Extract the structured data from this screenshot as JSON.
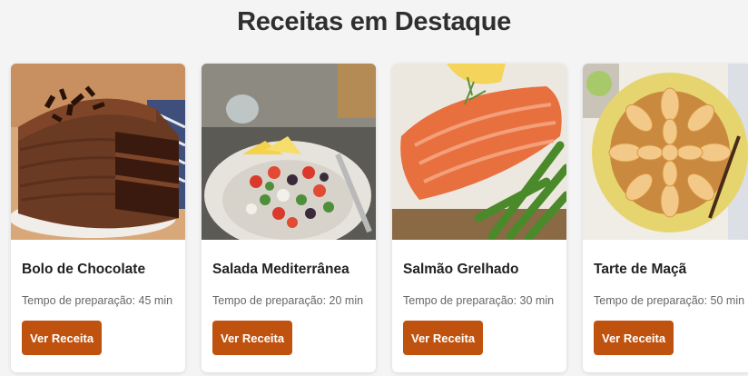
{
  "page": {
    "title": "Receitas em Destaque"
  },
  "recipes": [
    {
      "image": "chocolate-cake-photo",
      "title": "Bolo de Chocolate",
      "prep": "Tempo de preparação: 45 min",
      "button": "Ver Receita"
    },
    {
      "image": "mediterranean-salad-photo",
      "title": "Salada Mediterrânea",
      "prep": "Tempo de preparação: 20 min",
      "button": "Ver Receita"
    },
    {
      "image": "grilled-salmon-photo",
      "title": "Salmão Grelhado",
      "prep": "Tempo de preparação: 30 min",
      "button": "Ver Receita"
    },
    {
      "image": "apple-tart-photo",
      "title": "Tarte de Maçã",
      "prep": "Tempo de preparação: 50 min",
      "button": "Ver Receita"
    }
  ],
  "colors": {
    "button": "#c0520f",
    "background": "#f4f4f4",
    "card": "#ffffff"
  }
}
